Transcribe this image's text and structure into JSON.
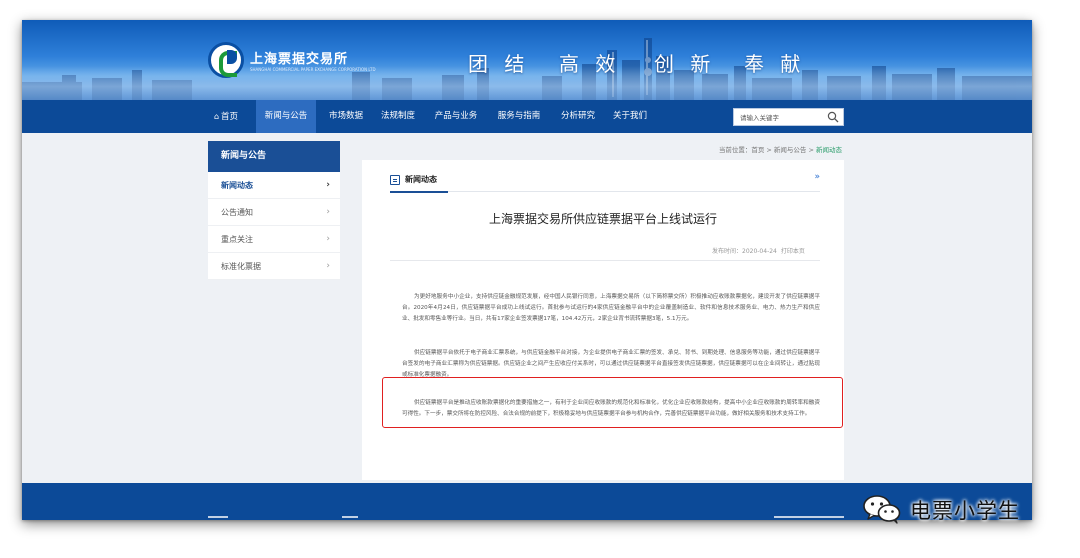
{
  "header": {
    "logo_text": "上海票据交易所",
    "logo_en": "SHANGHAI COMMERCIAL PAPER EXCHANGE CORPORATION LTD",
    "slogans": [
      "团 结",
      "高 效",
      "创 新",
      "奉 献"
    ],
    "colors": {
      "banner": "#1a5fb8",
      "nav": "#0c4a98",
      "nav_active": "#2d6cc0"
    }
  },
  "nav": {
    "items": [
      {
        "label": "首页",
        "icon": "home-icon"
      },
      {
        "label": "新闻与公告",
        "active": true
      },
      {
        "label": "市场数据"
      },
      {
        "label": "法规制度"
      },
      {
        "label": "产品与业务"
      },
      {
        "label": "服务与指南"
      },
      {
        "label": "分析研究"
      },
      {
        "label": "关于我们"
      }
    ],
    "search_placeholder": "请输入关键字"
  },
  "sidebar": {
    "title": "新闻与公告",
    "items": [
      {
        "label": "新闻动态",
        "active": true
      },
      {
        "label": "公告通知"
      },
      {
        "label": "重点关注"
      },
      {
        "label": "标准化票据"
      }
    ]
  },
  "breadcrumb": {
    "prefix": "当前位置：首页 > 新闻与公告 > ",
    "current": "新闻动态"
  },
  "article": {
    "section_title": "新闻动态",
    "more": "»",
    "title": "上海票据交易所供应链票据平台上线试运行",
    "meta": "发布时间：2020-04-24",
    "print": "打印本页",
    "paragraphs": [
      "为更好地服务中小企业，支持供应链金融规范发展，经中国人民银行同意，上海票据交易所（以下简称票交所）积极推动应收账款票据化，建设开发了供应链票据平台。2020年4月24日，供应链票据平台成功上线试运行。首批参与试运行的4家供应链金融平台中的企业覆盖制造业、软件和信息技术服务业、电力、热力生产和供应业、批发和零售业等行业。当日，共有17家企业签发票据17笔，104.42万元，2家企业背书流转票据3笔，5.1万元。",
      "供应链票据平台依托于电子商业汇票系统，与供应链金融平台对接，为企业提供电子商业汇票的签发、承兑、背书、到期处理、信息服务等功能，通过供应链票据平台签发的电子商业汇票称为供应链票据。供应链企业之间产生应收应付关系时，可以通过供应链票据平台直接签发供应链票据，供应链票据可以在企业间转让，通过贴现或标准化票据融资。",
      "供应链票据平台是推动应收账款票据化的重要措施之一，有利于企业间应收账款的规范化和标准化，优化企业应收账款结构，提高中小企业应收账款的周转率和融资可得性。下一步，票交所将在防控风险、合法合规的前提下，积极稳妥地与供应链票据平台参与机构合作，完善供应链票据平台功能，做好相关服务和技术支持工作。"
    ]
  },
  "watermark": {
    "text": "电票小学生",
    "icon": "wechat-icon"
  }
}
